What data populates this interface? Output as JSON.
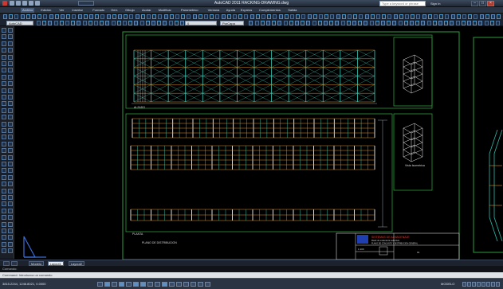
{
  "app": {
    "title": "AutoCAD 2011   RACKING-DRAWING.dwg",
    "search_placeholder": "Type a keyword or phrase",
    "sign_in": "Sign In",
    "window_controls": {
      "minimize": "–",
      "maximize": "□",
      "close": "×"
    }
  },
  "ribbon": {
    "tabs": [
      "Archivo",
      "Edición",
      "Ver",
      "Insertar",
      "Formato",
      "Herr.",
      "Dibujo",
      "Acotar",
      "Modificar",
      "Parametrico",
      "Ventana",
      "Ayuda",
      "Express",
      "Complementos",
      "Salida"
    ]
  },
  "toolbar": {
    "workspace_value": "AutoCAD",
    "layer_value": "0",
    "color_value": "PorCapa"
  },
  "drawing": {
    "elevation_label": "ALZADO",
    "plan_label": "PLANTA",
    "notes_label": "PLANO DE DISTRIBUCION",
    "view_caption": "Vista Isometrica",
    "titleblock": {
      "company": "SISTEMAS DE ALMACENAJE",
      "project": "Rack de estanteria selectiva",
      "subtitle": "PLANO DE CONJUNTO Y DISTRIBUCION GENERAL",
      "scale": "1:100",
      "sheet": "01"
    }
  },
  "layout_tabs": {
    "tabs": [
      "Modelo",
      "Layout1",
      "Layout2"
    ],
    "active_index": 1
  },
  "command": {
    "history": "Comando:",
    "prompt": "Command: Introduzca un comando"
  },
  "status": {
    "coords": "3815.2244, 1246.8021, 0.0000",
    "right_label": "MODELO"
  },
  "colors": {
    "frame": "#2e9d3a",
    "upright": "#2fb8a8",
    "beam": "#e0922a",
    "text": "#d7d7d7"
  }
}
